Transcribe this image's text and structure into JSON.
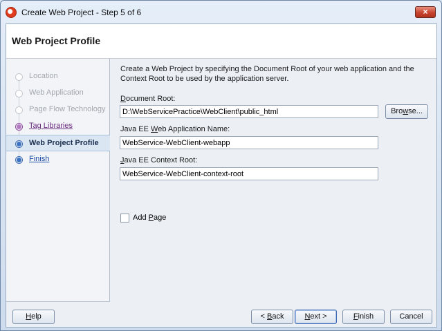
{
  "window": {
    "title": "Create Web Project - Step 5 of 6",
    "close_label": "×"
  },
  "header": {
    "title": "Web Project Profile"
  },
  "nav": {
    "items": [
      {
        "label": "Location",
        "state": "disabled"
      },
      {
        "label": "Web Application",
        "state": "disabled"
      },
      {
        "label": "Page Flow Technology",
        "state": "disabled"
      },
      {
        "label": "Tag Libraries",
        "state": "visited"
      },
      {
        "label": "Web Project Profile",
        "state": "current"
      },
      {
        "label": "Finish",
        "state": "link"
      }
    ]
  },
  "content": {
    "intro": "Create a Web Project by specifying the Document Root of your web application and the Context Root to be used by the application server.",
    "document_root": {
      "label_pre": "",
      "label_mnemonic": "D",
      "label_post": "ocument Root:",
      "value": "D:\\WebServicePractice\\WebClient\\public_html"
    },
    "browse_label_pre": "Bro",
    "browse_label_mnemonic": "w",
    "browse_label_post": "se...",
    "app_name": {
      "label_pre": "Java EE ",
      "label_mnemonic": "W",
      "label_post": "eb Application Name:",
      "value": "WebService-WebClient-webapp"
    },
    "context_root": {
      "label_pre": "",
      "label_mnemonic": "J",
      "label_post": "ava EE Context Root:",
      "value": "WebService-WebClient-context-root"
    },
    "add_page": {
      "label_pre": "Add ",
      "label_mnemonic": "P",
      "label_post": "age",
      "checked": false
    }
  },
  "footer": {
    "help_mnemonic": "H",
    "help_rest": "elp",
    "back_pre": "< ",
    "back_mnemonic": "B",
    "back_post": "ack",
    "next_mnemonic": "N",
    "next_post": "ext >",
    "finish_mnemonic": "F",
    "finish_post": "inish",
    "cancel_label": "Cancel"
  }
}
